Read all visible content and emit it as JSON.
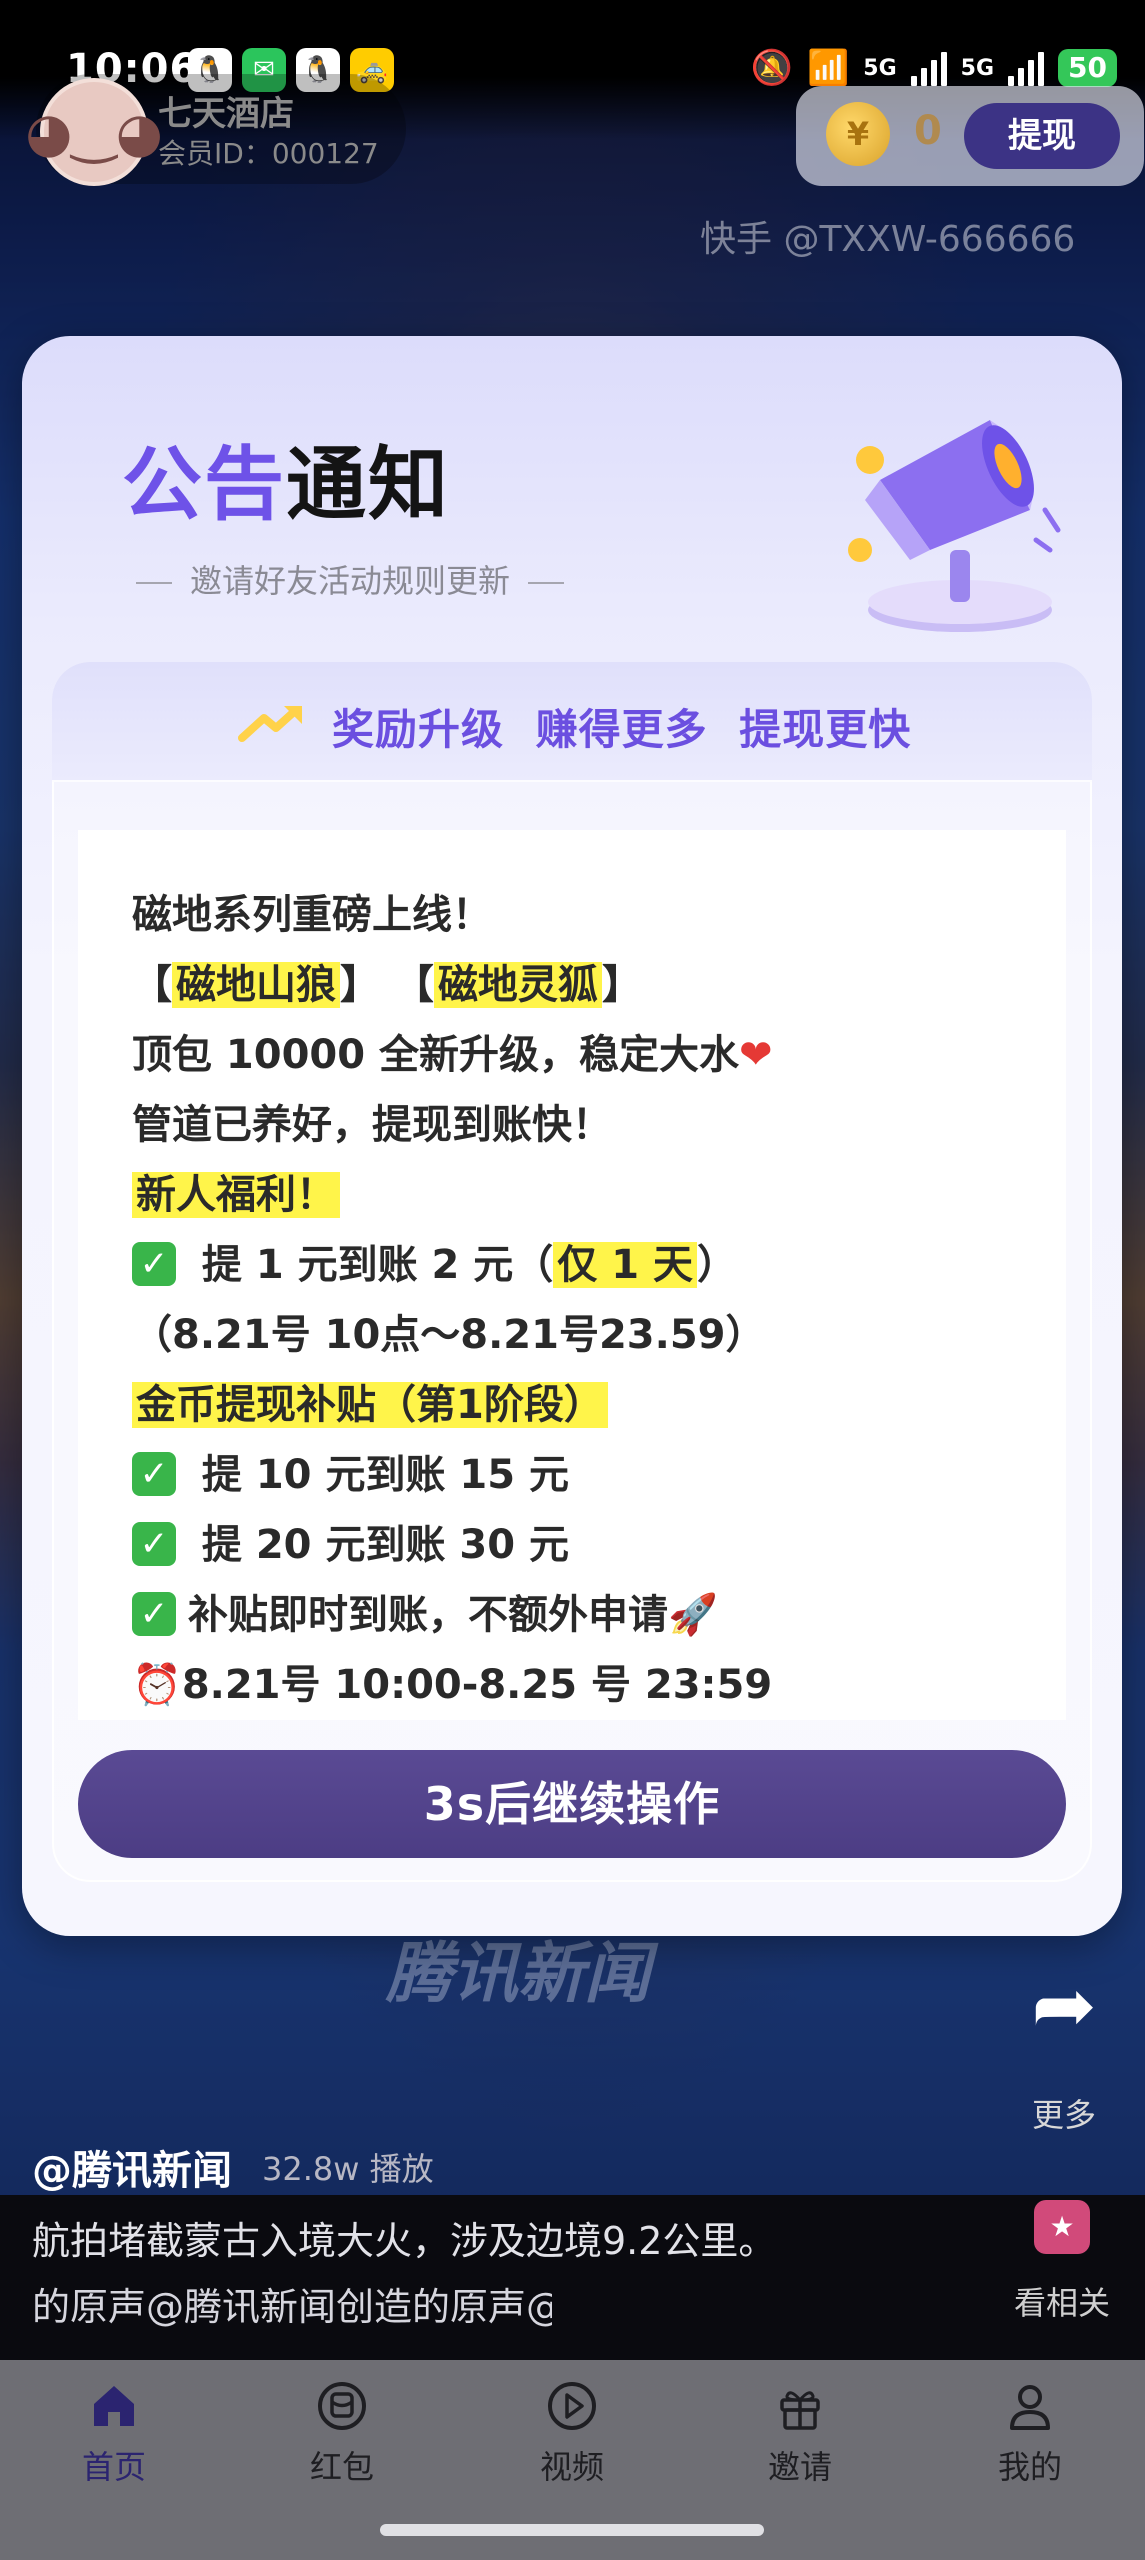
{
  "status_bar": {
    "time": "10:06",
    "apps": [
      "QQ",
      "微信",
      "QQ",
      "🚕"
    ],
    "network": "5G",
    "battery": "50"
  },
  "user": {
    "name": "七天酒店",
    "member_id": "会员ID：000127"
  },
  "wallet": {
    "coin_symbol": "¥",
    "coins": "0",
    "withdraw_label": "提现"
  },
  "watermark": "快手 @TXXW-666666",
  "modal": {
    "title_part1": "公告",
    "title_part2": "通知",
    "subtitle": "邀请好友活动规则更新",
    "reward_line": "奖励升级 赚得更多 提现更快",
    "lines": [
      {
        "text": "磁地系列重磅上线！"
      },
      {
        "prefix": "【",
        "hl": "磁地山狼",
        "mid": "】 【",
        "hl2": "磁地灵狐",
        "suffix": "】"
      },
      {
        "text": "顶包 10000 全新升级，稳定大水",
        "emoji": "❤"
      },
      {
        "text": "管道已养好，提现到账快！"
      },
      {
        "hl_full": "新人福利！"
      },
      {
        "check": "✓",
        "text": " 提 1 元到账 2 元（",
        "hl": "仅 1 天",
        "suffix": "）"
      },
      {
        "text": "（8.21号 10点～8.21号23.59）"
      },
      {
        "hl_full": "金币提现补贴（第1阶段）"
      },
      {
        "check": "✓",
        "text": " 提 10 元到账 15 元"
      },
      {
        "check": "✓",
        "text": " 提 20 元到账 30 元"
      },
      {
        "check": "✓",
        "text": "补贴即时到账，不额外申请",
        "emoji": "🚀"
      },
      {
        "emoji_prefix": "⏰",
        "text": "8.21号 10:00-8.25 号 23:59"
      }
    ],
    "continue_label": "3s后继续操作"
  },
  "video": {
    "news_logo": "腾讯新闻",
    "author": "@腾讯新闻",
    "plays": "32.8w 播放",
    "caption": "航拍堵截蒙古入境大火，涉及边境9.2公里。",
    "music": "的原声@腾讯新闻创造的原声@",
    "more_label": "更多",
    "related_label": "看相关"
  },
  "bottom_nav": [
    {
      "label": "首页",
      "icon": "home-icon"
    },
    {
      "label": "红包",
      "icon": "red-packet-icon"
    },
    {
      "label": "视频",
      "icon": "video-icon"
    },
    {
      "label": "邀请",
      "icon": "gift-icon"
    },
    {
      "label": "我的",
      "icon": "profile-icon"
    }
  ],
  "colors": {
    "accent": "#6b4fe0",
    "button": "#4c3d84",
    "highlight": "#fff44a",
    "check": "#39b54a"
  }
}
